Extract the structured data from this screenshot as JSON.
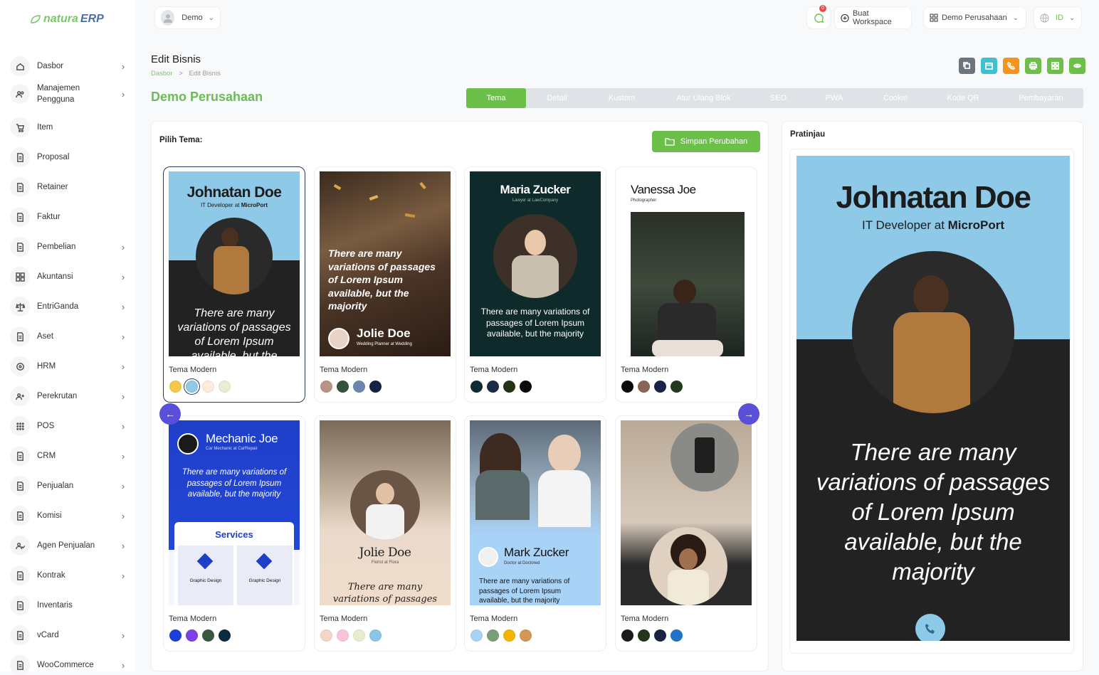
{
  "brand": {
    "part1": "natura",
    "part2": "ERP"
  },
  "sidebar": {
    "items": [
      {
        "label": "Dasbor",
        "icon": "home-icon",
        "chevron": true
      },
      {
        "label": "Manajemen Pengguna",
        "icon": "users-icon",
        "chevron": true
      },
      {
        "label": "Item",
        "icon": "cart-icon",
        "chevron": false
      },
      {
        "label": "Proposal",
        "icon": "proposal-icon",
        "chevron": false
      },
      {
        "label": "Retainer",
        "icon": "retainer-icon",
        "chevron": false
      },
      {
        "label": "Faktur",
        "icon": "invoice-icon",
        "chevron": false
      },
      {
        "label": "Pembelian",
        "icon": "purchase-icon",
        "chevron": true
      },
      {
        "label": "Akuntansi",
        "icon": "accounting-icon",
        "chevron": true
      },
      {
        "label": "EntriGanda",
        "icon": "scale-icon",
        "chevron": true
      },
      {
        "label": "Aset",
        "icon": "asset-icon",
        "chevron": true
      },
      {
        "label": "HRM",
        "icon": "hrm-icon",
        "chevron": true
      },
      {
        "label": "Perekrutan",
        "icon": "recruit-icon",
        "chevron": true
      },
      {
        "label": "POS",
        "icon": "pos-grid-icon",
        "chevron": true
      },
      {
        "label": "CRM",
        "icon": "crm-icon",
        "chevron": true
      },
      {
        "label": "Penjualan",
        "icon": "sales-icon",
        "chevron": true
      },
      {
        "label": "Komisi",
        "icon": "commission-icon",
        "chevron": true
      },
      {
        "label": "Agen Penjualan",
        "icon": "agent-icon",
        "chevron": true
      },
      {
        "label": "Kontrak",
        "icon": "contract-icon",
        "chevron": true
      },
      {
        "label": "Inventaris",
        "icon": "inventory-icon",
        "chevron": false
      },
      {
        "label": "vCard",
        "icon": "vcard-icon",
        "chevron": true
      },
      {
        "label": "WooCommerce",
        "icon": "woocommerce-icon",
        "chevron": true
      }
    ]
  },
  "topbar": {
    "user": "Demo",
    "notif_count": "0",
    "workspace_btn": "Buat Workspace",
    "company_select": "Demo Perusahaan",
    "lang": "ID"
  },
  "page": {
    "title": "Edit Bisnis",
    "breadcrumb_home": "Dasbor",
    "breadcrumb_sep": ">",
    "breadcrumb_current": "Edit Bisnis",
    "company": "Demo Perusahaan"
  },
  "actions": [
    {
      "name": "copy",
      "icon": "copy-icon",
      "color": "#6c757d"
    },
    {
      "name": "calendar",
      "icon": "calendar-icon",
      "color": "#3ec1d3"
    },
    {
      "name": "phone",
      "icon": "phone-icon",
      "color": "#f7941d"
    },
    {
      "name": "print",
      "icon": "print-icon",
      "color": "#6cc04a"
    },
    {
      "name": "grid",
      "icon": "grid-icon",
      "color": "#6cc04a"
    },
    {
      "name": "view",
      "icon": "eye-icon",
      "color": "#6cc04a"
    }
  ],
  "tabs": [
    "Tema",
    "Detail",
    "Kustom",
    "Atur Ulang Blok",
    "SEO",
    "PWA",
    "Cookie",
    "Kode QR",
    "Pembayaran"
  ],
  "active_tab": "Tema",
  "theme_section": {
    "label": "Pilih Tema:",
    "save_btn": "Simpan Perubahan"
  },
  "preview_label": "Pratinjau",
  "lorem_short": "There are many variations of passages of Lorem Ipsum available, but the majority",
  "lorem_cut": "There are many variations of passages of Lorem Ipsum available, but the",
  "cards": [
    {
      "name": "Tema Modern",
      "person": "Johnatan Doe",
      "role_prefix": "IT Developer at ",
      "role_company": "MicroPort",
      "swatches": [
        "#f5c84a",
        "#8ec9e8",
        "#fcecd8",
        "#e6efd0"
      ],
      "selected_swatch": 1
    },
    {
      "name": "Tema Modern",
      "person": "Jolie Doe",
      "subtitle": "Wedding Planner at Wedding",
      "swatches": [
        "#b99485",
        "#35523f",
        "#6a86ae",
        "#142243"
      ]
    },
    {
      "name": "Tema Modern",
      "person": "Maria Zucker",
      "subtitle": "Lawyer at LawCompany",
      "swatches": [
        "#0e2b35",
        "#1a2b48",
        "#233315",
        "#0b0b0b"
      ]
    },
    {
      "name": "Tema Modern",
      "person": "Vanessa Joe",
      "subtitle": "Photographer",
      "swatches": [
        "#0b0b0b",
        "#896556",
        "#1a2344",
        "#25391c"
      ]
    },
    {
      "name": "Tema Modern",
      "person": "Mechanic Joe",
      "subtitle": "Car Mechanic at CarRepair",
      "services": "Services",
      "service_item": "Graphic Design",
      "swatches": [
        "#1d3fd9",
        "#7d3fe6",
        "#3a5a3d",
        "#0c2a40"
      ]
    },
    {
      "name": "Tema Modern",
      "person": "Jolie Doe",
      "subtitle": "Florist at Flora",
      "lorem_cut": "There are many variations of passages of",
      "swatches": [
        "#f2d6c6",
        "#f9c3d9",
        "#e6ecd0",
        "#89c6e8"
      ]
    },
    {
      "name": "Tema Modern",
      "person": "Mark Zucker",
      "subtitle": "Doctor at Doctored",
      "swatches": [
        "#a9d2f7",
        "#7a9f78",
        "#f5b400",
        "#d39654"
      ]
    },
    {
      "name": "Tema Modern",
      "swatches": [
        "#1a1a1a",
        "#24351c",
        "#1a2344",
        "#2073c9"
      ]
    }
  ],
  "preview": {
    "person": "Johnatan Doe",
    "role_prefix": "IT Developer at ",
    "role_company": "MicroPort"
  }
}
